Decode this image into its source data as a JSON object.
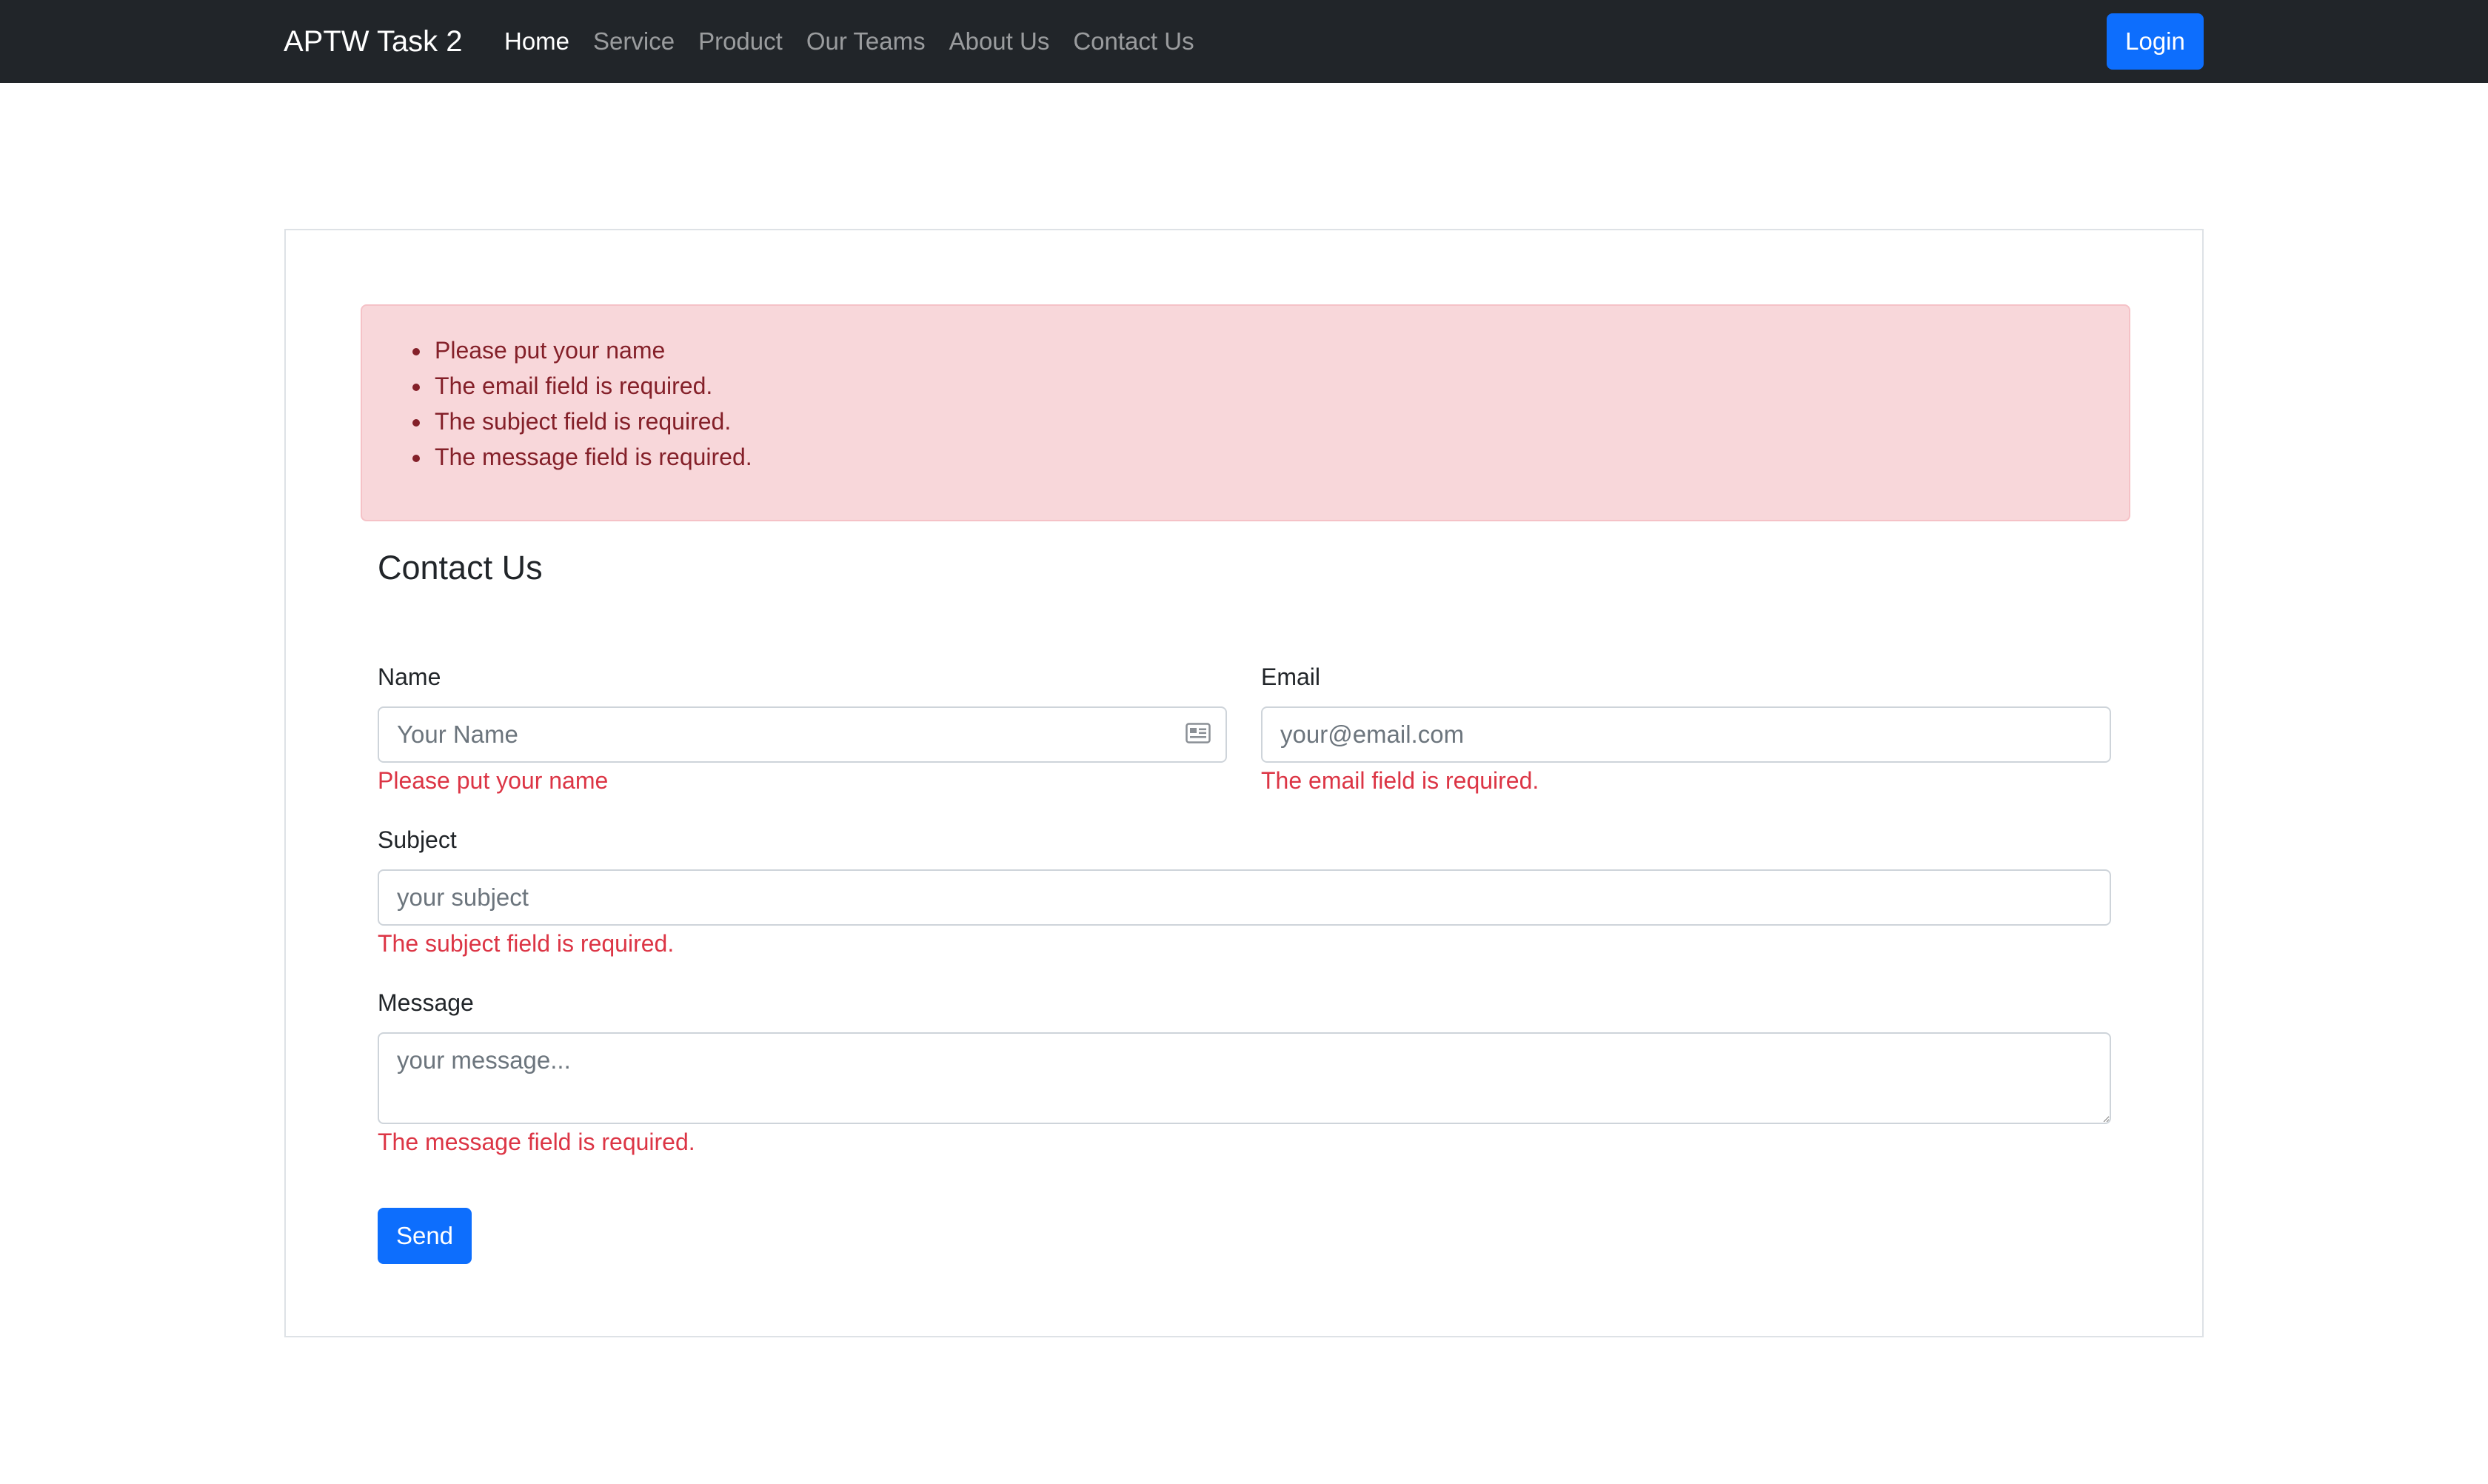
{
  "navbar": {
    "brand": "APTW Task 2",
    "links": [
      {
        "label": "Home",
        "active": true
      },
      {
        "label": "Service",
        "active": false
      },
      {
        "label": "Product",
        "active": false
      },
      {
        "label": "Our Teams",
        "active": false
      },
      {
        "label": "About Us",
        "active": false
      },
      {
        "label": "Contact Us",
        "active": false
      }
    ],
    "login_label": "Login"
  },
  "alert": {
    "errors": [
      "Please put your name",
      "The email field is required.",
      "The subject field is required.",
      "The message field is required."
    ]
  },
  "form": {
    "title": "Contact Us",
    "name": {
      "label": "Name",
      "placeholder": "Your Name",
      "value": "",
      "error": "Please put your name",
      "icon": "contact-card-icon"
    },
    "email": {
      "label": "Email",
      "placeholder": "your@email.com",
      "value": "",
      "error": "The email field is required."
    },
    "subject": {
      "label": "Subject",
      "placeholder": "your subject",
      "value": "",
      "error": "The subject field is required."
    },
    "message": {
      "label": "Message",
      "placeholder": "your message...",
      "value": "",
      "error": "The message field is required."
    },
    "send_label": "Send"
  },
  "colors": {
    "navbar_bg": "#212529",
    "primary": "#0d6efd",
    "alert_bg": "#f8d7da",
    "alert_text": "#842029",
    "error_text": "#dc3545"
  }
}
